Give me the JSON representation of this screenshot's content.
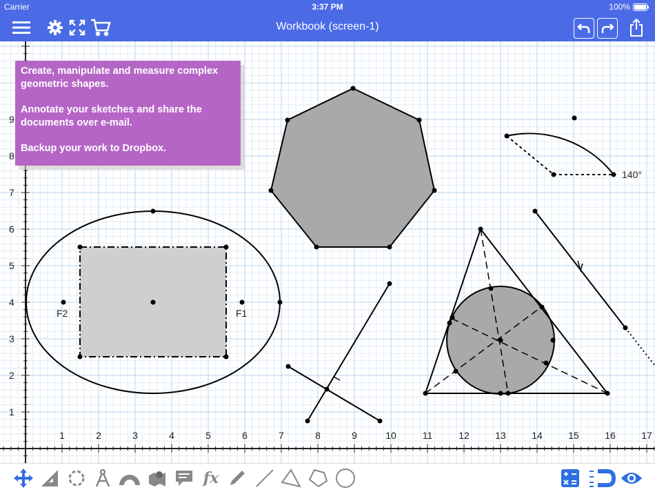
{
  "status": {
    "carrier": "Carrier",
    "time": "3:37 PM",
    "battery": "100%"
  },
  "nav": {
    "title": "Workbook (screen-1)"
  },
  "info": {
    "line1": "Create, manipulate and measure complex geometric shapes.",
    "line2": "Annotate your sketches and share the documents over e-mail.",
    "line3": "Backup your work to Dropbox."
  },
  "axes": {
    "x_ticks": [
      "1",
      "2",
      "3",
      "4",
      "5",
      "6",
      "7",
      "8",
      "9",
      "10",
      "11",
      "12",
      "13",
      "14",
      "15",
      "16",
      "17"
    ],
    "y_ticks": [
      "1",
      "2",
      "3",
      "4",
      "5",
      "6",
      "7",
      "8",
      "9"
    ]
  },
  "labels": {
    "f1": "F1",
    "f2": "F2",
    "angle": "140°"
  },
  "colors": {
    "bar": "#4a6ae6",
    "accent": "#2f6fe0",
    "info_bg": "#b565c6",
    "shape_fill": "#a9a9a9",
    "rect_fill": "#cfcfcf"
  },
  "icons": {
    "nav_left": [
      "menu-icon",
      "gear-icon",
      "fullscreen-icon",
      "cart-icon"
    ],
    "nav_right": [
      "undo-icon",
      "redo-icon",
      "share-icon"
    ],
    "tools": [
      "move-icon",
      "ruler-triangle-icon",
      "rotate-icon",
      "compass-icon",
      "protractor-icon",
      "map-icon",
      "comment-icon",
      "function-icon",
      "pencil-icon",
      "line-tool-icon",
      "triangle-tool-icon",
      "polygon-tool-icon",
      "circle-tool-icon",
      "calculator-icon",
      "magnet-icon",
      "eye-icon"
    ]
  }
}
